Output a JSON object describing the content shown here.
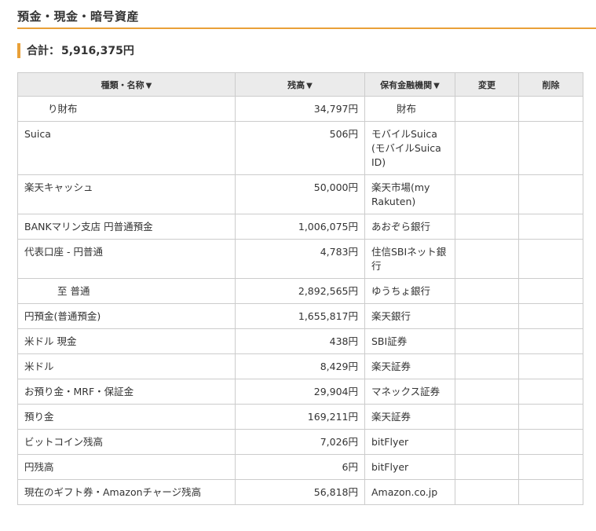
{
  "page": {
    "title": "預金・現金・暗号資産",
    "total_label": "合計：",
    "total_value": "5,916,375円"
  },
  "table": {
    "headers": {
      "name": "種類・名称",
      "balance": "残高",
      "institution": "保有金融機関",
      "edit": "変更",
      "delete": "削除"
    },
    "rows": [
      {
        "name": "り財布",
        "balance": "34,797円",
        "institution": "財布"
      },
      {
        "name": "Suica",
        "balance": "506円",
        "institution": "モバイルSuica (モバイルSuica ID)"
      },
      {
        "name": "楽天キャッシュ",
        "balance": "50,000円",
        "institution": "楽天市場(my Rakuten)"
      },
      {
        "name": "BANKマリン支店 円普通預金",
        "balance": "1,006,075円",
        "institution": "あおぞら銀行"
      },
      {
        "name": "代表口座 - 円普通",
        "balance": "4,783円",
        "institution": "住信SBIネット銀行"
      },
      {
        "name": "至 普通",
        "balance": "2,892,565円",
        "institution": "ゆうちょ銀行"
      },
      {
        "name": "円預金(普通預金)",
        "balance": "1,655,817円",
        "institution": "楽天銀行"
      },
      {
        "name": "米ドル 現金",
        "balance": "438円",
        "institution": "SBI証券"
      },
      {
        "name": "米ドル",
        "balance": "8,429円",
        "institution": "楽天証券"
      },
      {
        "name": "お預り金・MRF・保証金",
        "balance": "29,904円",
        "institution": "マネックス証券"
      },
      {
        "name": "預り金",
        "balance": "169,211円",
        "institution": "楽天証券"
      },
      {
        "name": "ビットコイン残高",
        "balance": "7,026円",
        "institution": "bitFlyer"
      },
      {
        "name": "円残高",
        "balance": "6円",
        "institution": "bitFlyer"
      },
      {
        "name": "現在のギフト券・Amazonチャージ残高",
        "balance": "56,818円",
        "institution": "Amazon.co.jp"
      }
    ]
  },
  "icons": {
    "sort": "caret-down-icon"
  },
  "colors": {
    "accent": "#e9a038",
    "header_bg": "#ebebeb",
    "border": "#cccccc",
    "text": "#333333"
  }
}
